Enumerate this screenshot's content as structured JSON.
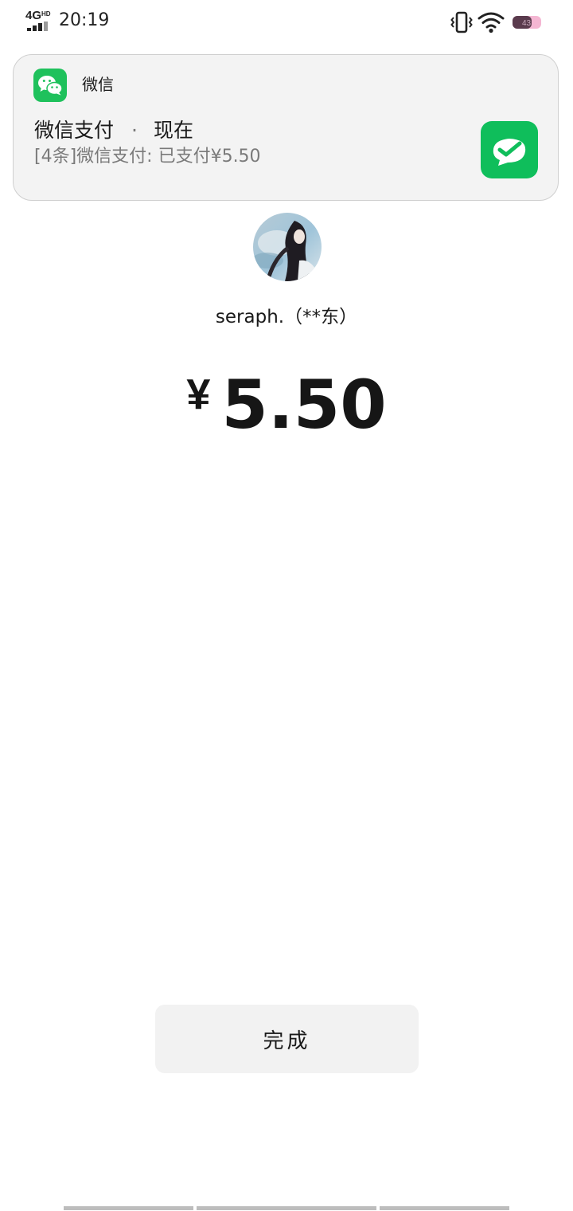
{
  "status_bar": {
    "network": "4G",
    "network_sup": "HD",
    "time": "20:19",
    "battery_level": "43",
    "icons": [
      "signal-icon",
      "vibrate-icon",
      "wifi-icon",
      "battery-icon"
    ]
  },
  "notification": {
    "app_name": "微信",
    "title": "微信支付",
    "separator": "·",
    "time": "现在",
    "body": "[4条]微信支付: 已支付¥5.50",
    "app_icon": "wechat-icon",
    "thumbnail_icon": "wechat-pay-icon",
    "accent_color": "#1fc15c"
  },
  "payment": {
    "payee": "seraph.（**东）",
    "currency_symbol": "¥",
    "amount": "5.50",
    "avatar": "avatar-image"
  },
  "actions": {
    "done_label": "完成"
  }
}
